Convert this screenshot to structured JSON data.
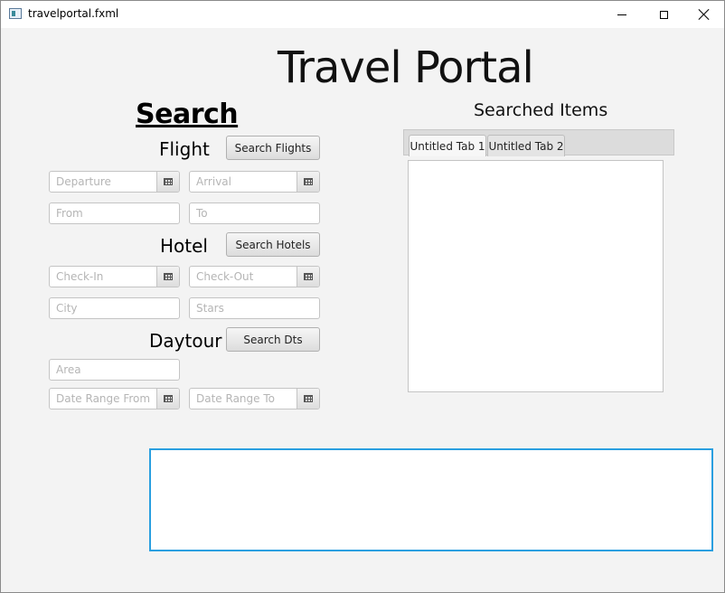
{
  "window": {
    "title": "travelportal.fxml"
  },
  "app": {
    "title": "Travel Portal"
  },
  "search": {
    "heading": "Search",
    "flight": {
      "label": "Flight",
      "button": "Search Flights",
      "departure_placeholder": "Departure",
      "arrival_placeholder": "Arrival",
      "from_placeholder": "From",
      "to_placeholder": "To"
    },
    "hotel": {
      "label": "Hotel",
      "button": "Search Hotels",
      "checkin_placeholder": "Check-In",
      "checkout_placeholder": "Check-Out",
      "city_placeholder": "City",
      "stars_placeholder": "Stars"
    },
    "daytour": {
      "label": "Daytour",
      "button": "Search Dts",
      "area_placeholder": "Area",
      "range_from_placeholder": "Date Range From",
      "range_to_placeholder": "Date Range To"
    }
  },
  "results": {
    "title": "Searched Items",
    "tabs": [
      {
        "label": "Untitled Tab 1",
        "selected": true
      },
      {
        "label": "Untitled Tab 2",
        "selected": false
      }
    ]
  },
  "output": {
    "value": ""
  },
  "colors": {
    "focus_border": "#2a9fe0",
    "background": "#f3f3f3"
  }
}
